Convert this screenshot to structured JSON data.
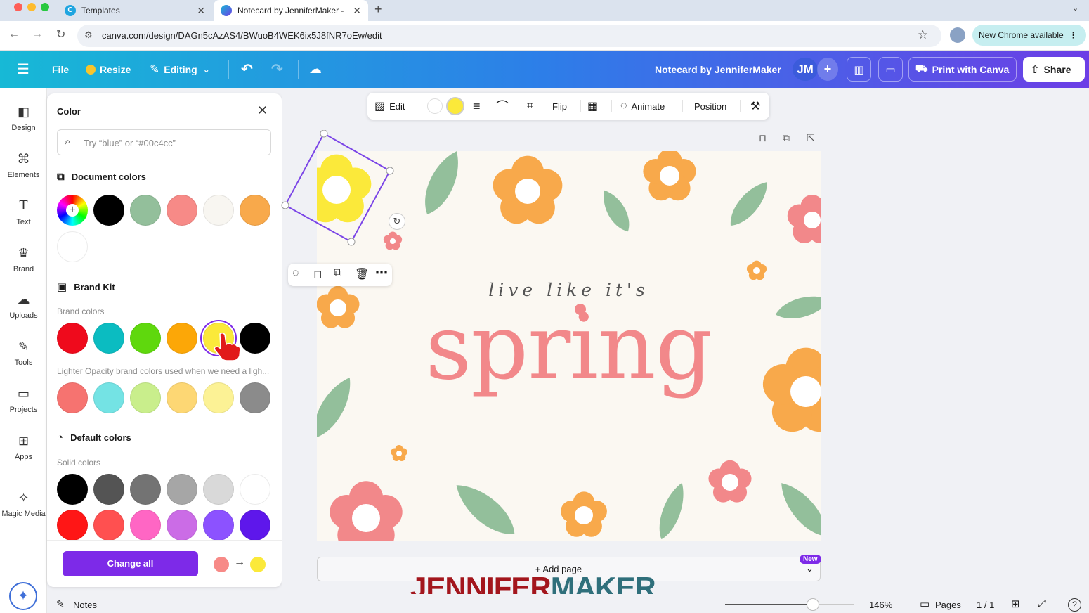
{
  "browser": {
    "tabs": [
      {
        "title": "Templates"
      },
      {
        "title": "Notecard by JenniferMaker -"
      }
    ],
    "new_tab": "+",
    "url": "canva.com/design/DAGn5cAzAS4/BWuoB4WEK6ix5J8fNR7oEw/edit",
    "new_chrome": "New Chrome available"
  },
  "topbar": {
    "file": "File",
    "resize": "Resize",
    "editing": "Editing",
    "doc_title": "Notecard by JenniferMaker",
    "avatar": "JM",
    "print": "Print with Canva",
    "share": "Share"
  },
  "rail": [
    {
      "label": "Design",
      "icon": "design-icon"
    },
    {
      "label": "Elements",
      "icon": "elements-icon"
    },
    {
      "label": "Text",
      "icon": "text-icon"
    },
    {
      "label": "Brand",
      "icon": "brand-icon"
    },
    {
      "label": "Uploads",
      "icon": "uploads-icon"
    },
    {
      "label": "Tools",
      "icon": "tools-icon"
    },
    {
      "label": "Projects",
      "icon": "projects-icon"
    },
    {
      "label": "Apps",
      "icon": "apps-icon"
    },
    {
      "label": "Magic Media",
      "icon": "magic-media-icon"
    }
  ],
  "panel": {
    "title": "Color",
    "search_placeholder": "Try “blue” or “#00c4cc”",
    "document_colors_title": "Document colors",
    "document_colors": [
      "#000000",
      "#93bf9b",
      "#f78a87",
      "#f8f6f1",
      "#f8a94b",
      "#ffffff"
    ],
    "brand_kit_title": "Brand Kit",
    "brand_colors_label": "Brand colors",
    "brand_colors": [
      "#ef0a1c",
      "#0bbcc1",
      "#5fd80d",
      "#fca707",
      "#fbe93a",
      "#000000"
    ],
    "lighter_label": "Lighter Opacity brand colors used when we need a ligh...",
    "lighter_colors": [
      "#f67370",
      "#74e3e4",
      "#c9ee8c",
      "#fdd774",
      "#fcf295",
      "#8b8b8b"
    ],
    "default_colors_title": "Default colors",
    "solid_label": "Solid colors",
    "solid_row1": [
      "#000000",
      "#545454",
      "#737373",
      "#a6a6a6",
      "#d9d9d9",
      "#ffffff"
    ],
    "solid_row2": [
      "#ff1616",
      "#ff5050",
      "#ff66c4",
      "#cb6ce6",
      "#8c52ff",
      "#5e17eb"
    ],
    "change_all": "Change all",
    "from_color": "#f78a87",
    "to_color": "#fbe93a"
  },
  "context_toolbar": {
    "edit": "Edit",
    "fill_color": "#fbe93a",
    "flip": "Flip",
    "animate": "Animate",
    "position": "Position"
  },
  "design": {
    "tagline": "live like it's",
    "headline": "spring",
    "accent_pink": "#f2888a",
    "accent_orange": "#f8a94b",
    "accent_green": "#93bf9b",
    "accent_yellow": "#fbe93a"
  },
  "add_page": {
    "label": "+ Add page",
    "badge": "New"
  },
  "watermark": {
    "part1": "JENNIFER",
    "part2": "MAKER"
  },
  "bottom": {
    "notes": "Notes",
    "zoom": "146%",
    "pages": "Pages",
    "page_count": "1 / 1",
    "zoom_fraction": 0.68
  }
}
